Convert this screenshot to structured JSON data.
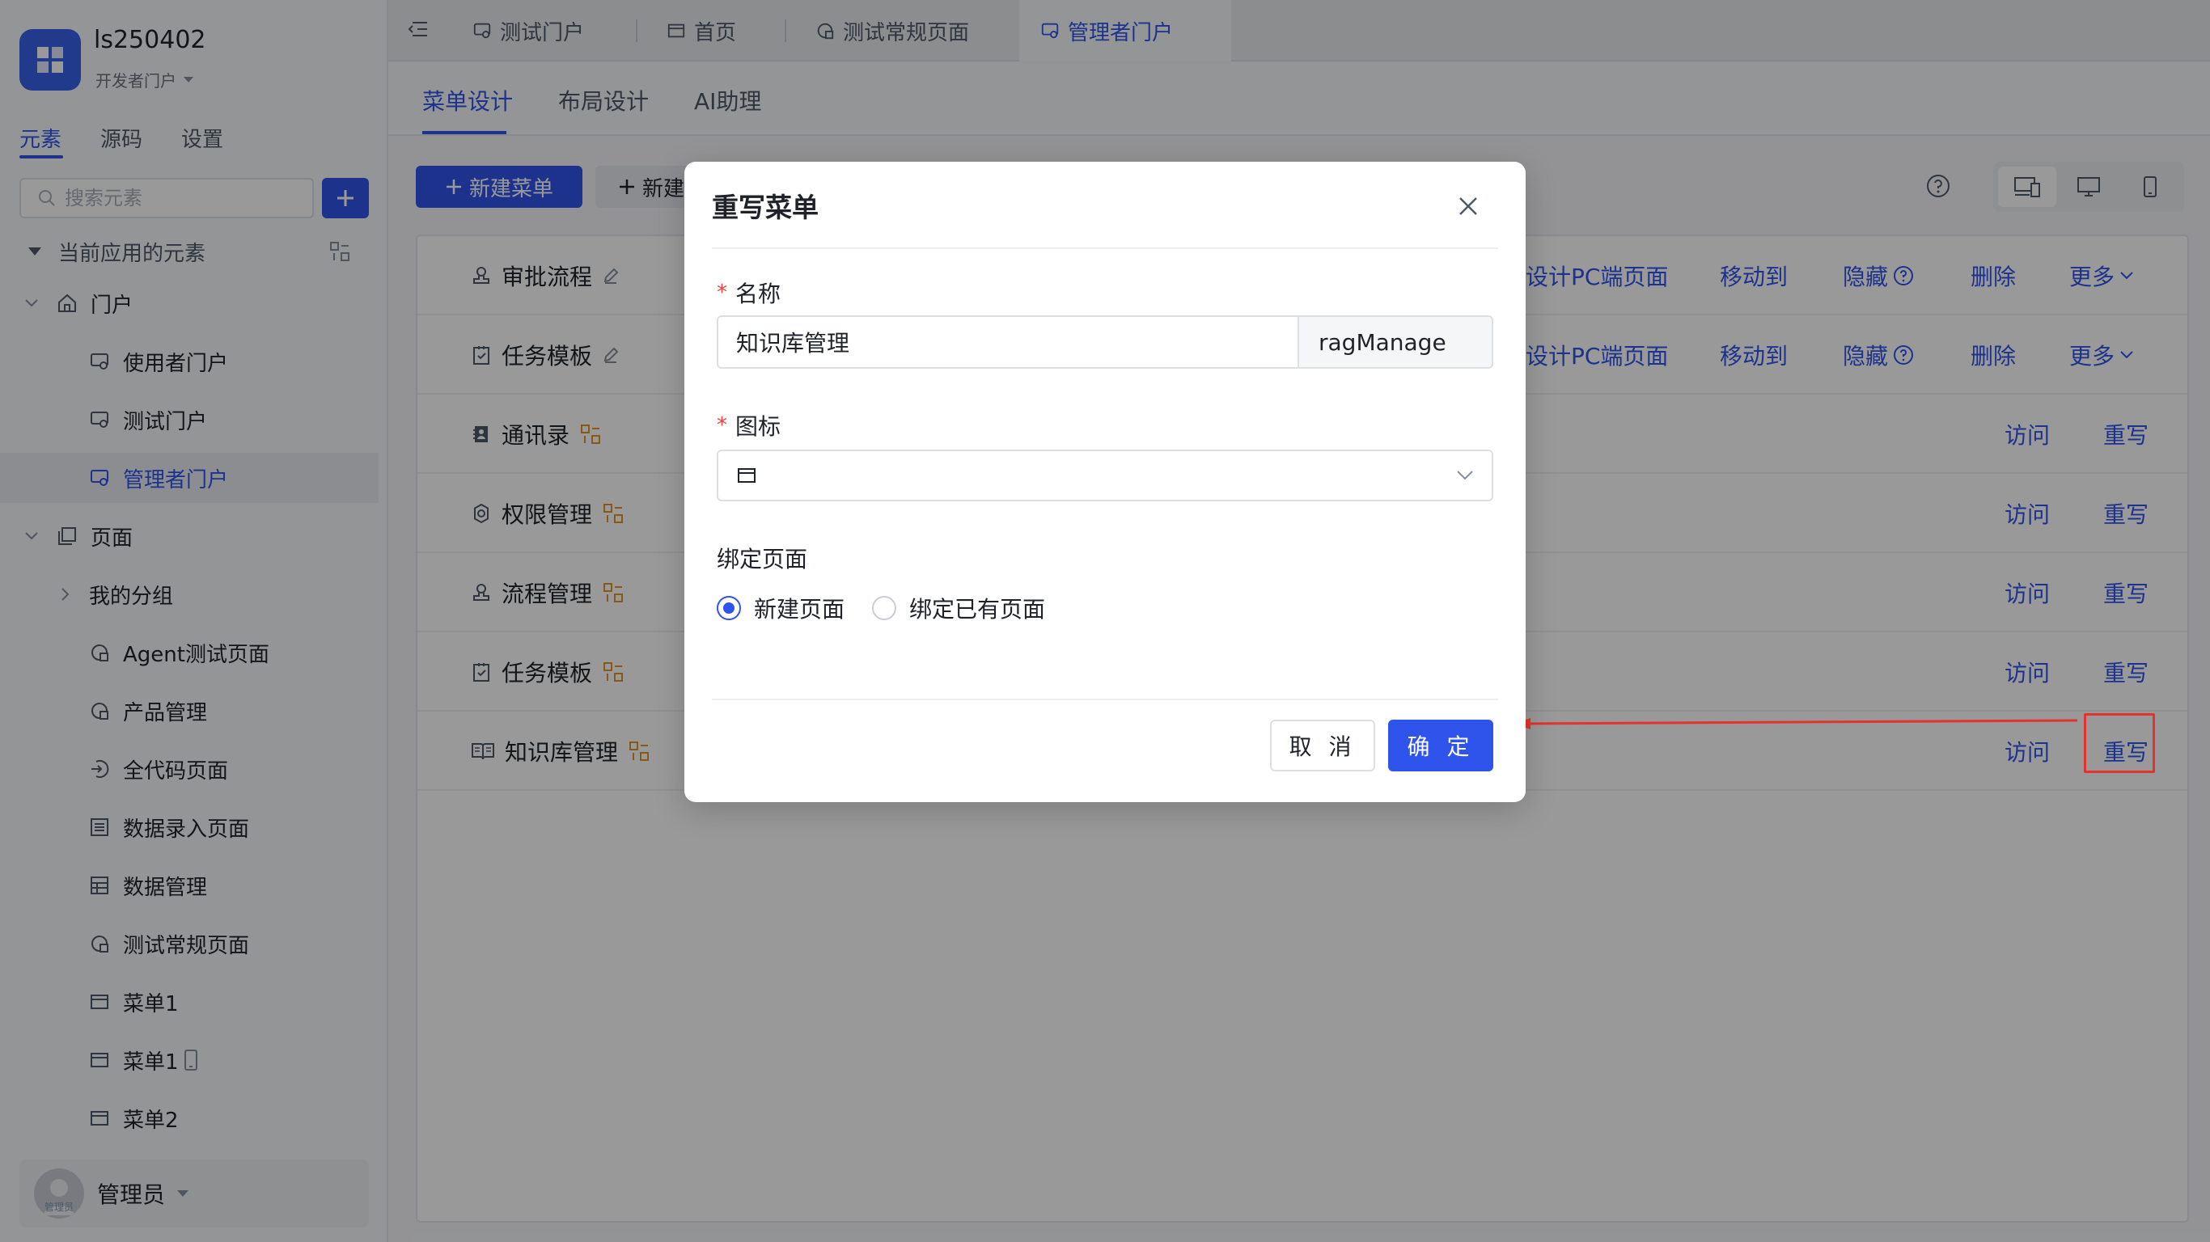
{
  "app": {
    "name": "ls250402",
    "subtitle": "开发者门户"
  },
  "sidebar": {
    "tabs": [
      "元素",
      "源码",
      "设置"
    ],
    "search_placeholder": "搜索元素",
    "section_title": "当前应用的元素",
    "tree": [
      {
        "label": "门户",
        "icon": "portal-icon"
      },
      {
        "label": "使用者门户",
        "icon": "screen-icon"
      },
      {
        "label": "测试门户",
        "icon": "screen-icon"
      },
      {
        "label": "管理者门户",
        "icon": "screen-icon"
      },
      {
        "label": "页面",
        "icon": "pages-icon"
      },
      {
        "label": "我的分组",
        "icon": "chevron-right-icon"
      },
      {
        "label": "Agent测试页面",
        "icon": "page-g-icon"
      },
      {
        "label": "产品管理",
        "icon": "page-g-icon"
      },
      {
        "label": "全代码页面",
        "icon": "code-page-icon"
      },
      {
        "label": "数据录入页面",
        "icon": "form-page-icon"
      },
      {
        "label": "数据管理",
        "icon": "table-page-icon"
      },
      {
        "label": "测试常规页面",
        "icon": "page-g-icon"
      },
      {
        "label": "菜单1",
        "icon": "window-icon"
      },
      {
        "label": "菜单1",
        "icon": "window-icon"
      },
      {
        "label": "菜单2",
        "icon": "window-icon"
      }
    ],
    "user": {
      "name": "管理员",
      "avatar_text": "管理员"
    }
  },
  "topbar": {
    "tabs": [
      "测试门户",
      "首页",
      "测试常规页面",
      "管理者门户"
    ]
  },
  "subbar": {
    "tabs": [
      "菜单设计",
      "布局设计",
      "AI助理"
    ]
  },
  "toolbar": {
    "new_menu": "新建菜单",
    "new_second": "新建"
  },
  "menu_rows": [
    {
      "name": "审批流程",
      "ops": [
        "设计PC端页面",
        "移动到",
        "隐藏",
        "删除",
        "更多"
      ]
    },
    {
      "name": "任务模板",
      "ops": [
        "设计PC端页面",
        "移动到",
        "隐藏",
        "删除",
        "更多"
      ]
    },
    {
      "name": "通讯录",
      "ops": [
        "访问",
        "重写"
      ]
    },
    {
      "name": "权限管理",
      "ops": [
        "访问",
        "重写"
      ]
    },
    {
      "name": "流程管理",
      "ops": [
        "访问",
        "重写"
      ]
    },
    {
      "name": "任务模板",
      "ops": [
        "访问",
        "重写"
      ]
    },
    {
      "name": "知识库管理",
      "ops": [
        "访问",
        "重写"
      ]
    }
  ],
  "modal": {
    "title": "重写菜单",
    "name_label": "名称",
    "name_value": "知识库管理",
    "name_code": "ragManage",
    "icon_label": "图标",
    "bind_label": "绑定页面",
    "radio_new": "新建页面",
    "radio_existing": "绑定已有页面",
    "cancel": "取 消",
    "ok": "确 定"
  },
  "colors": {
    "accent": "#2f54eb",
    "danger": "#e5322d",
    "warning": "#f0a030"
  }
}
